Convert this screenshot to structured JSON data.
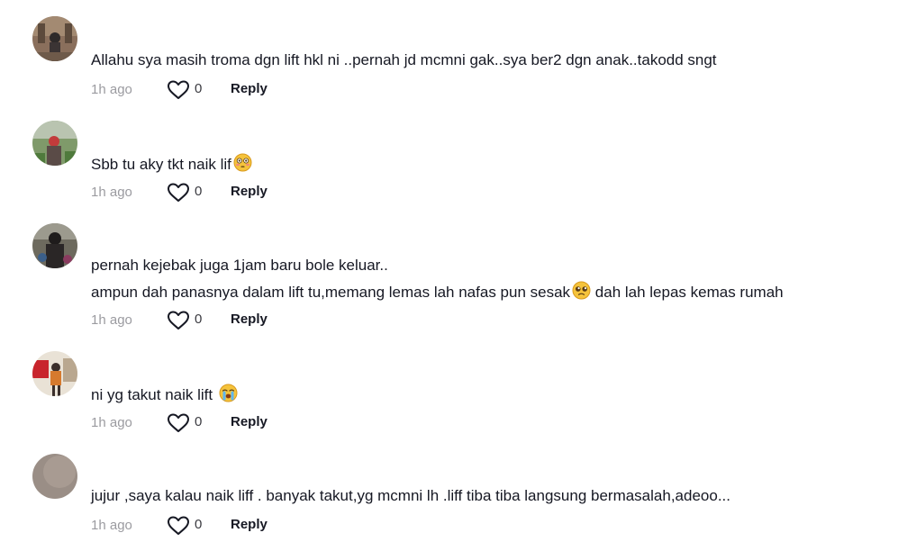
{
  "comments": [
    {
      "username": "",
      "lines": [
        "Allahu sya masih troma dgn lift hkl ni ..pernah jd mcmni gak..sya ber2 dgn anak..takodd sngt"
      ],
      "emoji": "",
      "time": "1h ago",
      "likes": "0",
      "reply": "Reply"
    },
    {
      "username": "",
      "lines": [
        "Sbb tu aky tkt naik lif"
      ],
      "emoji": "flushed-face-icon",
      "time": "1h ago",
      "likes": "0",
      "reply": "Reply"
    },
    {
      "username": "",
      "lines": [
        "pernah kejebak juga 1jam baru bole keluar..",
        "ampun dah panasnya dalam lift tu,memang lemas lah nafas pun sesak",
        "dah lah lepas kemas rumah"
      ],
      "emoji": "pleading-face-icon",
      "time": "1h ago",
      "likes": "0",
      "reply": "Reply"
    },
    {
      "username": "",
      "lines": [
        "ni yg takut naik lift"
      ],
      "emoji": "crying-face-icon",
      "time": "1h ago",
      "likes": "0",
      "reply": "Reply"
    },
    {
      "username": "",
      "lines": [
        "jujur ,saya kalau naik liff . banyak takut,yg mcmni lh .liff tiba tiba langsung bermasalah,adeoo..."
      ],
      "emoji": "",
      "time": "1h ago",
      "likes": "0",
      "reply": "Reply"
    }
  ],
  "colors": {
    "text": "#161823",
    "muted": "#9b9ba0",
    "emoji": "#f5c33b"
  }
}
